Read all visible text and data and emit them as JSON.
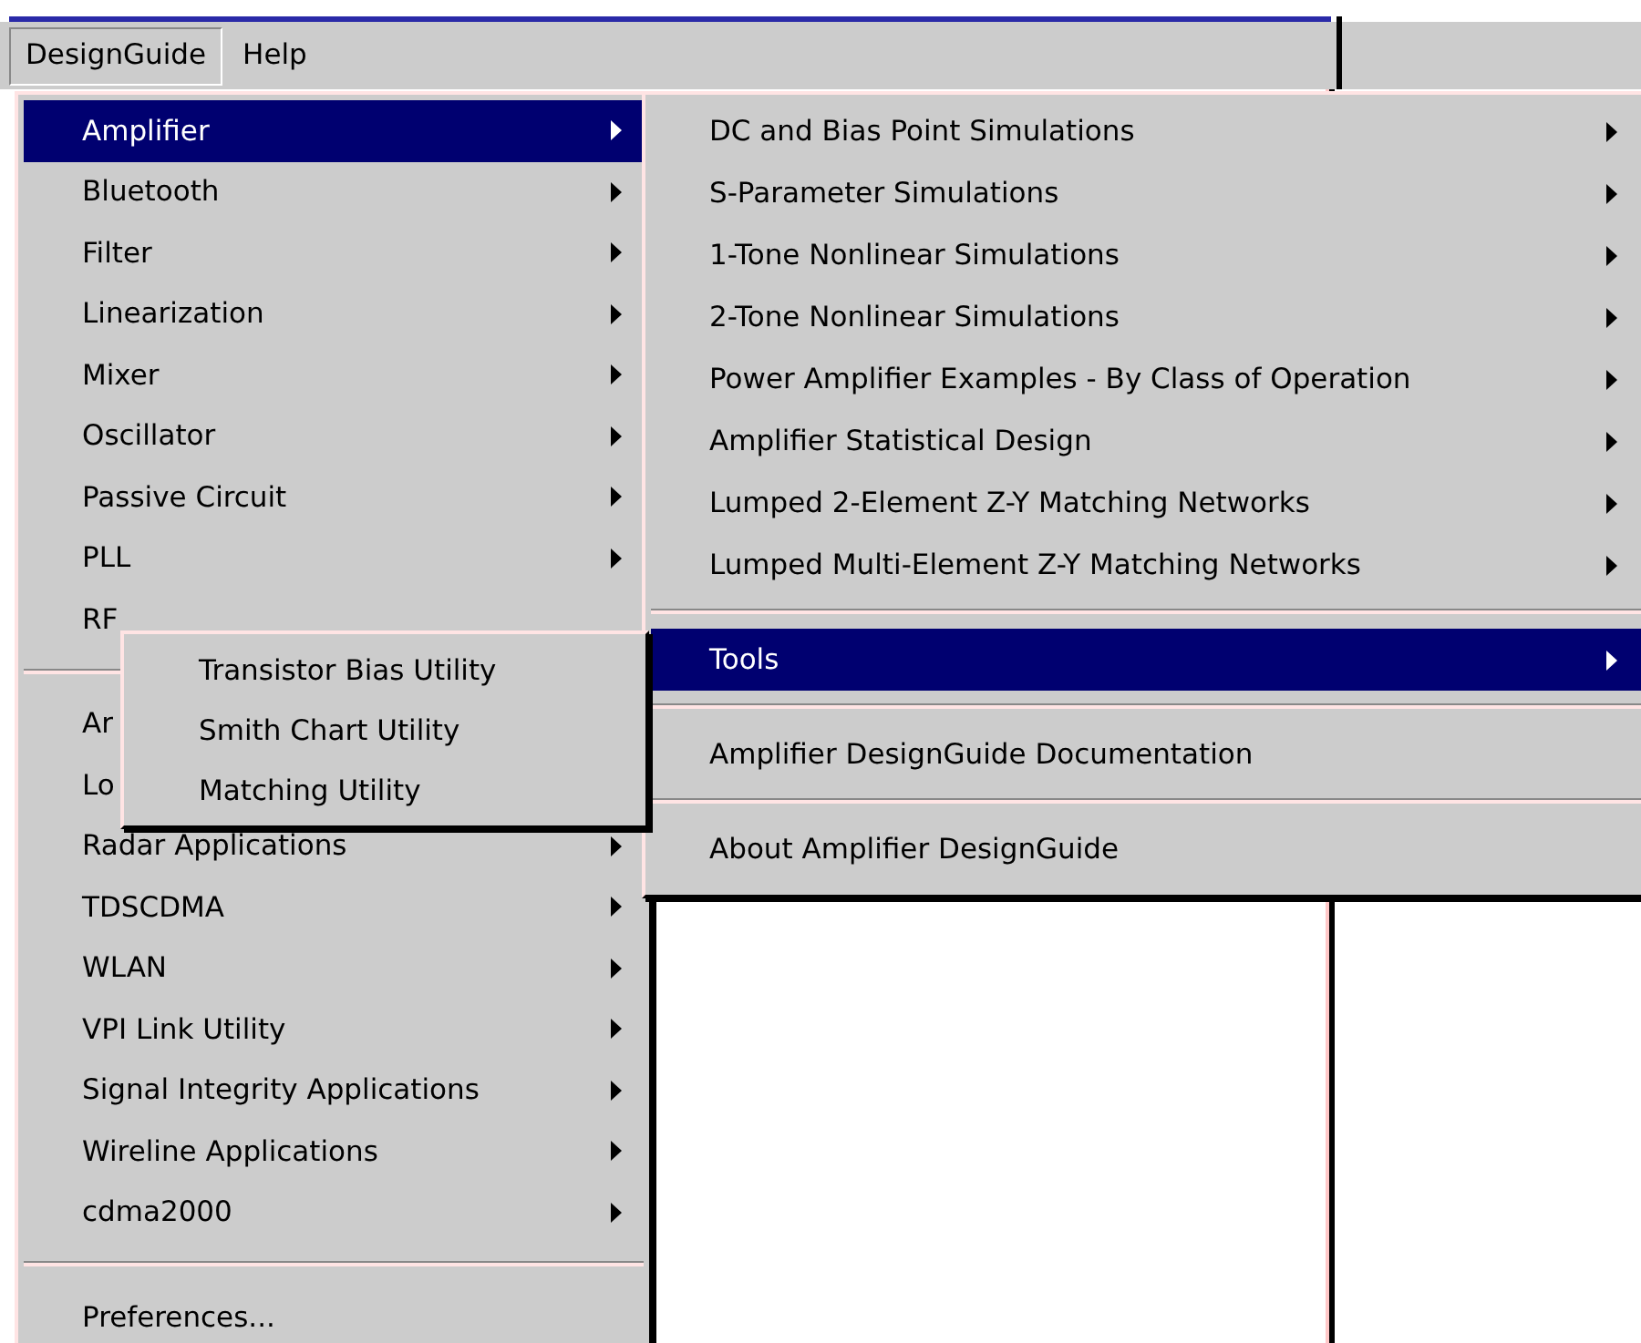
{
  "menubar": {
    "items": [
      {
        "label": "DesignGuide",
        "selected": true
      },
      {
        "label": "Help",
        "selected": false
      }
    ]
  },
  "menu": {
    "sections": [
      [
        {
          "label": "Amplifier",
          "submenu": true,
          "selected": true
        },
        {
          "label": "Bluetooth",
          "submenu": true,
          "selected": false
        },
        {
          "label": "Filter",
          "submenu": true,
          "selected": false
        },
        {
          "label": "Linearization",
          "submenu": true,
          "selected": false
        },
        {
          "label": "Mixer",
          "submenu": true,
          "selected": false
        },
        {
          "label": "Oscillator",
          "submenu": true,
          "selected": false
        },
        {
          "label": "Passive Circuit",
          "submenu": true,
          "selected": false
        },
        {
          "label": "PLL",
          "submenu": true,
          "selected": false
        },
        {
          "label": "RF",
          "submenu": false,
          "selected": false
        }
      ],
      [
        {
          "label": "Ar",
          "submenu": false,
          "selected": false
        },
        {
          "label": "Lo",
          "submenu": false,
          "selected": false
        },
        {
          "label": "Radar Applications",
          "submenu": true,
          "selected": false
        },
        {
          "label": "TDSCDMA",
          "submenu": true,
          "selected": false
        },
        {
          "label": "WLAN",
          "submenu": true,
          "selected": false
        },
        {
          "label": "VPI Link Utility",
          "submenu": true,
          "selected": false
        },
        {
          "label": "Signal Integrity Applications",
          "submenu": true,
          "selected": false
        },
        {
          "label": "Wireline Applications",
          "submenu": true,
          "selected": false
        },
        {
          "label": "cdma2000",
          "submenu": true,
          "selected": false
        }
      ],
      [
        {
          "label": "Preferences...",
          "submenu": false,
          "selected": false
        }
      ]
    ]
  },
  "submenu": {
    "sections": [
      [
        {
          "label": "DC and Bias Point Simulations",
          "submenu": true,
          "selected": false
        },
        {
          "label": "S-Parameter Simulations",
          "submenu": true,
          "selected": false
        },
        {
          "label": "1-Tone Nonlinear Simulations",
          "submenu": true,
          "selected": false
        },
        {
          "label": "2-Tone Nonlinear Simulations",
          "submenu": true,
          "selected": false
        },
        {
          "label": "Power Amplifier Examples - By Class of Operation",
          "submenu": true,
          "selected": false
        },
        {
          "label": "Amplifier Statistical Design",
          "submenu": true,
          "selected": false
        },
        {
          "label": "Lumped 2-Element Z-Y Matching Networks",
          "submenu": true,
          "selected": false
        },
        {
          "label": "Lumped Multi-Element Z-Y Matching Networks",
          "submenu": true,
          "selected": false
        }
      ],
      [
        {
          "label": "Tools",
          "submenu": true,
          "selected": true
        }
      ],
      [
        {
          "label": "Amplifier DesignGuide Documentation",
          "submenu": false,
          "selected": false
        }
      ],
      [
        {
          "label": "About Amplifier DesignGuide",
          "submenu": false,
          "selected": false
        }
      ]
    ]
  },
  "flyout": {
    "sections": [
      [
        {
          "label": "Transistor Bias Utility",
          "submenu": false,
          "selected": false
        },
        {
          "label": "Smith Chart Utility",
          "submenu": false,
          "selected": false
        },
        {
          "label": "Matching Utility",
          "submenu": false,
          "selected": false
        }
      ]
    ]
  }
}
